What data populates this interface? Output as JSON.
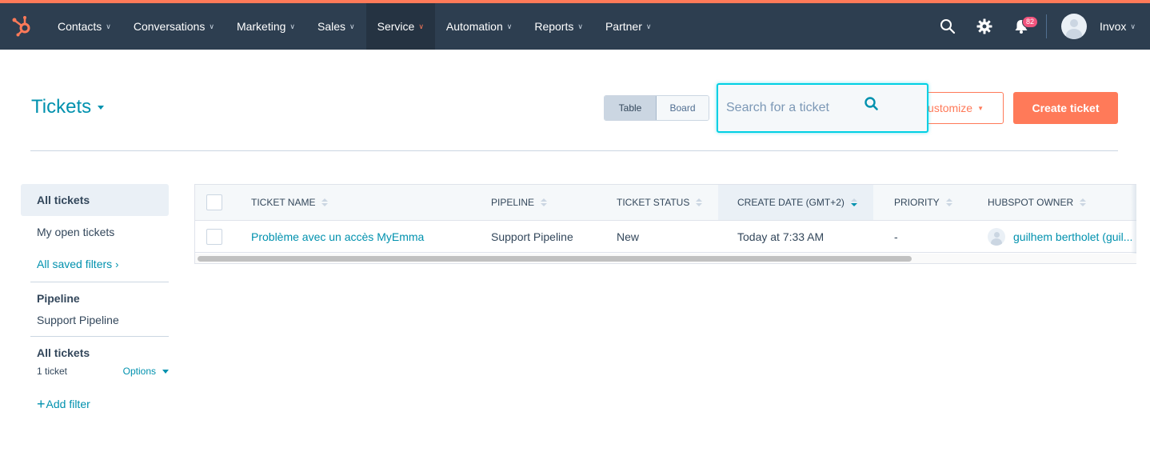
{
  "nav": {
    "items": [
      {
        "label": "Contacts"
      },
      {
        "label": "Conversations"
      },
      {
        "label": "Marketing"
      },
      {
        "label": "Sales"
      },
      {
        "label": "Service",
        "active": true
      },
      {
        "label": "Automation"
      },
      {
        "label": "Reports"
      },
      {
        "label": "Partner"
      }
    ],
    "notification_count": "82",
    "account_name": "Invox",
    "colors": {
      "bar": "#2d3e50",
      "accent": "#ff7a59",
      "badge": "#f2547d"
    }
  },
  "header": {
    "title": "Tickets",
    "view_table": "Table",
    "view_board": "Board",
    "search_placeholder": "Search for a ticket",
    "customize_label": "ustomize",
    "create_label": "Create ticket"
  },
  "sidebar": {
    "all_tickets": "All tickets",
    "my_open_tickets": "My open tickets",
    "all_saved_filters": "All saved filters",
    "pipeline_heading": "Pipeline",
    "pipeline_value": "Support Pipeline",
    "view_heading": "All tickets",
    "ticket_count": "1 ticket",
    "options_label": "Options",
    "add_filter": "Add filter"
  },
  "table": {
    "columns": [
      {
        "label": "Ticket name"
      },
      {
        "label": "Pipeline"
      },
      {
        "label": "Ticket status"
      },
      {
        "label": "Create date (GMT+2)",
        "sorted": "desc"
      },
      {
        "label": "Priority"
      },
      {
        "label": "Hubspot owner"
      }
    ],
    "rows": [
      {
        "ticket_name": "Problème avec un accès MyEmma",
        "pipeline": "Support Pipeline",
        "status": "New",
        "create_date": "Today at 7:33 AM",
        "priority": "-",
        "owner": "guilhem bertholet (guil..."
      }
    ]
  }
}
